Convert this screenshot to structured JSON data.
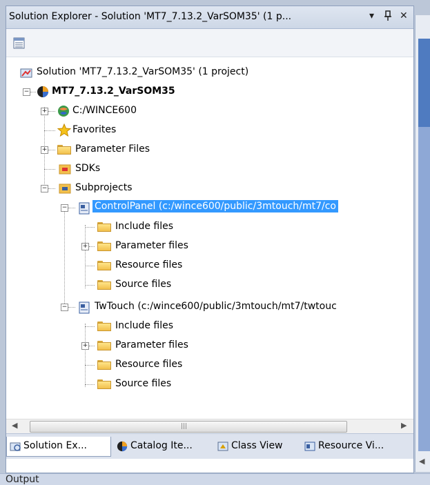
{
  "window": {
    "title": "Solution Explorer - Solution 'MT7_7.13.2_VarSOM35' (1 p...",
    "dropdown_glyph": "▾",
    "pin_glyph": "ꟽ",
    "close_glyph": "✕"
  },
  "toolbar": {
    "properties_icon": "properties-icon"
  },
  "tree": {
    "solution": "Solution 'MT7_7.13.2_VarSOM35' (1 project)",
    "project": "MT7_7.13.2_VarSOM35",
    "wince": "C:/WINCE600",
    "favorites": "Favorites",
    "parameter_files": "Parameter Files",
    "sdks": "SDKs",
    "subprojects": "Subprojects",
    "controlpanel": {
      "label": "ControlPanel (c:/wince600/public/3mtouch/mt7/co",
      "children": [
        "Include files",
        "Parameter files",
        "Resource files",
        "Source files"
      ]
    },
    "twtouch": {
      "label": "TwTouch (c:/wince600/public/3mtouch/mt7/twtouc",
      "children": [
        "Include files",
        "Parameter files",
        "Resource files",
        "Source files"
      ]
    },
    "expand_glyph": "+",
    "collapse_glyph": "−"
  },
  "hscroll": {
    "left_arrow": "◀",
    "right_arrow": "▶",
    "grip": "|||"
  },
  "tabs": [
    {
      "label": "Solution Ex...",
      "icon": "solution-explorer-icon",
      "active": true
    },
    {
      "label": "Catalog Ite...",
      "icon": "catalog-icon",
      "active": false
    },
    {
      "label": "Class View",
      "icon": "class-view-icon",
      "active": false
    },
    {
      "label": "Resource Vi...",
      "icon": "resource-view-icon",
      "active": false
    }
  ],
  "right_panel": {
    "arrow": "◀"
  },
  "output": {
    "label": "Output"
  }
}
